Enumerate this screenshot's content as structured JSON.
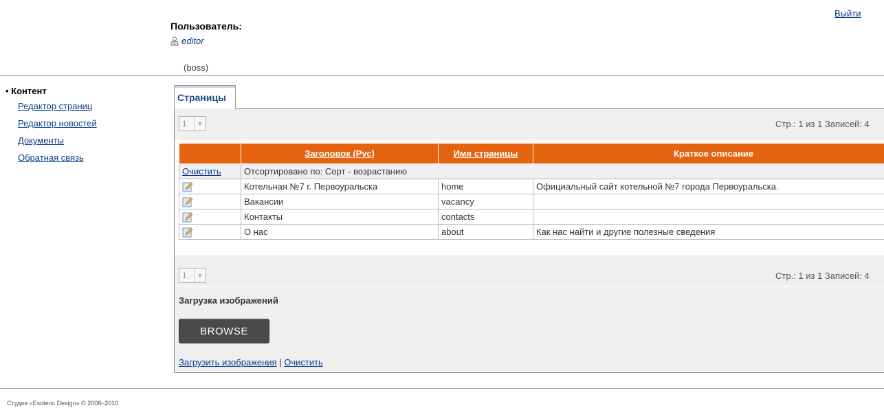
{
  "header": {
    "logout_label": "Выйти",
    "user_caption": "Пользователь:",
    "username": "editor",
    "role": "(boss)"
  },
  "sidebar": {
    "title": "Контент",
    "items": [
      {
        "label": "Редактор страниц"
      },
      {
        "label": "Редактор новостей"
      },
      {
        "label": "Документы"
      },
      {
        "label": "Обратная связь"
      }
    ]
  },
  "tab": {
    "label": "Страницы"
  },
  "pager": {
    "page_value": "1",
    "info": "Стр.: 1 из 1  Записей: 4"
  },
  "table": {
    "columns": [
      {
        "label": ""
      },
      {
        "label": "Заголовок (Рус)"
      },
      {
        "label": "Имя страницы"
      },
      {
        "label": "Краткое описание"
      }
    ],
    "clear_label": "Очистить",
    "sort_text": "Отсортировано по: Сорт - возрастанию",
    "rows": [
      {
        "title": "Котельная №7 г. Первоуральска",
        "name": "home",
        "desc": "Официальный сайт котельной №7 города Первоуральска."
      },
      {
        "title": "Вакансии",
        "name": "vacancy",
        "desc": ""
      },
      {
        "title": "Контакты",
        "name": "contacts",
        "desc": ""
      },
      {
        "title": "О нас",
        "name": "about",
        "desc": "Как нас найти и другие полезные сведения"
      }
    ]
  },
  "upload": {
    "title": "Загрузка изображений",
    "browse_label": "BROWSE",
    "upload_link": "Загрузить изображения",
    "separator": "|",
    "clear_link": "Очистить"
  },
  "footer": {
    "text": "Студия «Esoteric Design» © 2008–2010"
  },
  "colors": {
    "header_orange": "#e5620f",
    "link_blue": "#0a3a8c"
  }
}
